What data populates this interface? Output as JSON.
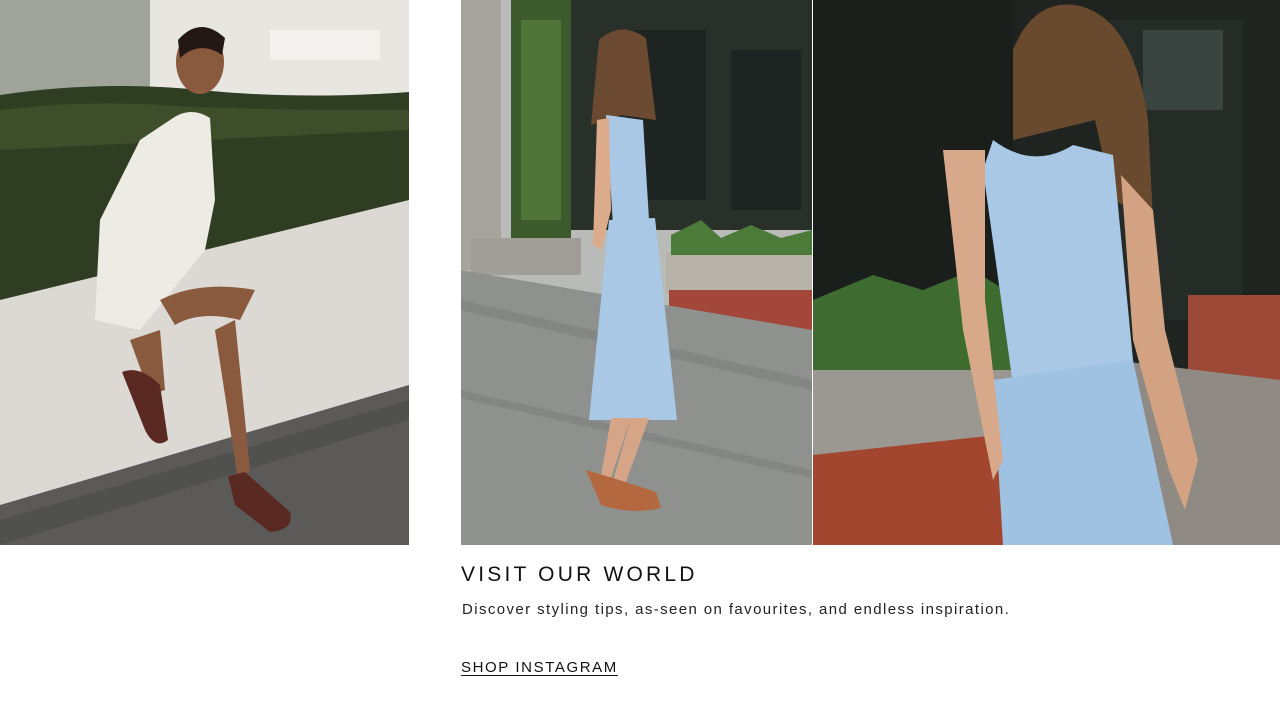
{
  "promo": {
    "heading": "VISIT OUR WORLD",
    "description": "Discover styling tips, as-seen on favourites, and endless inspiration.",
    "cta_label": "SHOP INSTAGRAM"
  }
}
